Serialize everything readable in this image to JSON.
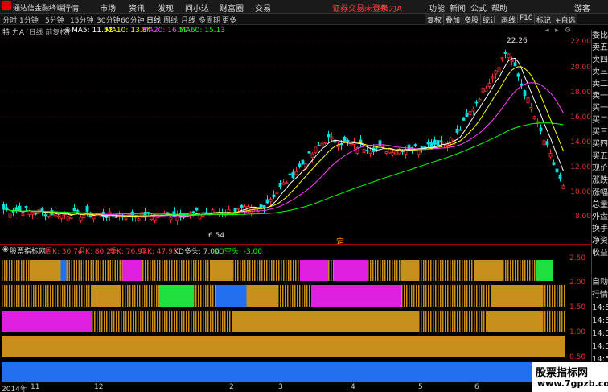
{
  "menubar": {
    "app_title": "通达信金融终端",
    "items": [
      "行情",
      "市场",
      "资讯",
      "发现",
      "问小达",
      "财富圈",
      "交易"
    ],
    "notice": "证券交易未登录",
    "stock_name": "特 力A",
    "right_items": [
      "功能",
      "新闻",
      "公式",
      "帮助"
    ],
    "user": "游客"
  },
  "toolbar": {
    "periods": [
      "分时",
      "1分钟",
      "5分钟",
      "15分钟",
      "30分钟",
      "60分钟",
      "日线",
      "周线",
      "月线",
      "多周期",
      "更多"
    ],
    "active_period": "日线",
    "buttons": [
      "复权",
      "叠加",
      "多股",
      "统计",
      "画线",
      "F10",
      "标记",
      "+自选"
    ]
  },
  "infobar": {
    "title": "特 力A",
    "subtitle": "(日线 前复权)",
    "ma5": "MA5: 11.52",
    "ma10": "MA10: 13.84",
    "ma20": "MA20: 16.59",
    "ma60": "MA60: 15.13"
  },
  "price_axis": [
    "22.00",
    "20.00",
    "18.00",
    "16.00",
    "14.00",
    "12.00",
    "10.00",
    "8.00"
  ],
  "annotations": {
    "high": "22.26",
    "low": "6.54",
    "marker": "定"
  },
  "indicator": {
    "name": "股票指标网",
    "week_k": "周K: 30.74",
    "month_k": "月K: 80.21",
    "quarter_k": "季K: 76.97",
    "year_k": "年K: 47.95",
    "kd_long": "KD多头: 7.00",
    "kd_short": "KD空头: -3.00",
    "axis": [
      "2.50",
      "2.00",
      "1.50",
      "1.00",
      "0.50"
    ]
  },
  "right_panel": [
    "委比",
    "卖五",
    "卖四",
    "卖三",
    "卖二",
    "卖一",
    "买一",
    "买二",
    "买三",
    "买四",
    "买五",
    "现价",
    "涨跌",
    "涨幅",
    "总量",
    "外盘",
    "换手",
    "净资",
    "收益"
  ],
  "right_panel2": [
    "自动",
    "行情",
    "14:50",
    "14:50",
    "14:50",
    "14:50",
    "14:50",
    "14:50",
    "14:50"
  ],
  "date_axis": [
    "2014年",
    "11",
    "12",
    "2",
    "3",
    "4",
    "5",
    "6"
  ],
  "watermark": {
    "line1": "股票指标网",
    "line2": "www.7gpzb.com"
  },
  "colors": {
    "up": "#ff3030",
    "down": "#00e0e0",
    "ma5": "#ffffff",
    "ma10": "#ffff00",
    "ma20": "#ff40ff",
    "ma60": "#00ff00",
    "gold": "#c8901a",
    "magenta": "#e020e0",
    "green": "#20e040",
    "blue": "#2070f0"
  }
}
